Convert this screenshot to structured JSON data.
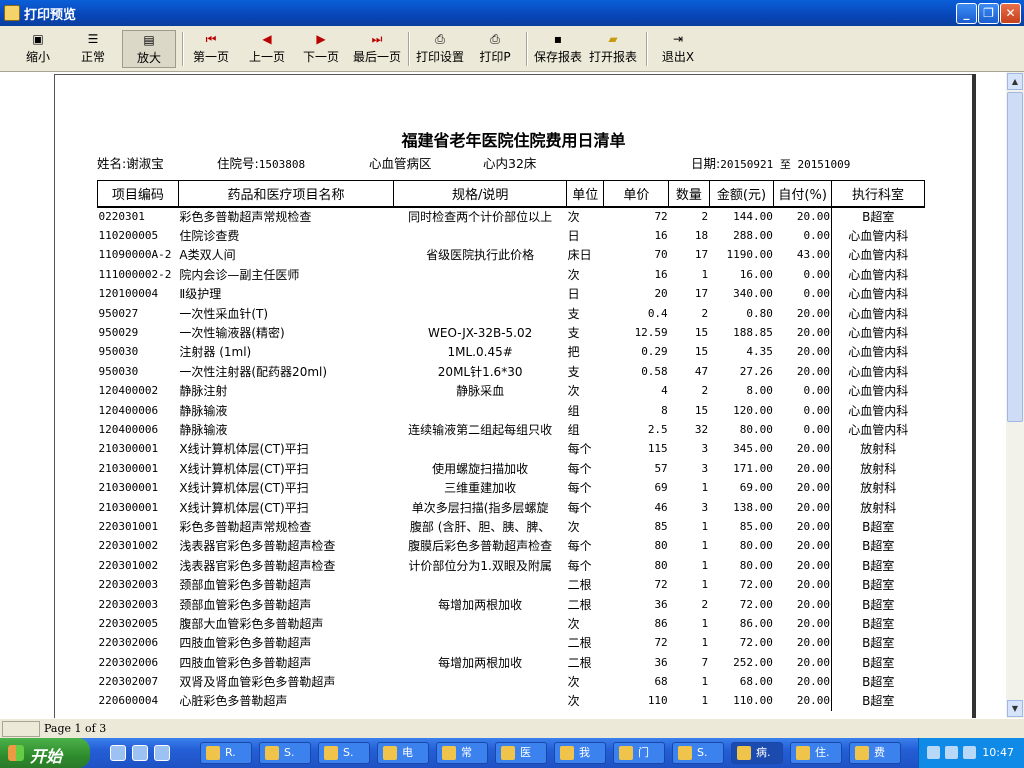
{
  "window": {
    "title": "打印预览"
  },
  "toolbar": {
    "shrink": "缩小",
    "normal": "正常",
    "zoom": "放大",
    "first": "第一页",
    "prev": "上一页",
    "next": "下一页",
    "last": "最后一页",
    "print_setup": "打印设置",
    "print": "打印P",
    "save_report": "保存报表",
    "open_report": "打开报表",
    "exit": "退出X"
  },
  "report": {
    "title": "福建省老年医院住院费用日清单",
    "name_label": "姓名:",
    "name": "谢淑宝",
    "admission_label": "住院号:",
    "admission_no": "1503808",
    "ward": "心血管病区",
    "bed": "心内32床",
    "date_label": "日期:",
    "date_range": "20150921 至 20151009",
    "columns": [
      "项目编码",
      "药品和医疗项目名称",
      "规格/说明",
      "单位",
      "单价",
      "数量",
      "金额(元)",
      "自付(%)",
      "执行科室"
    ],
    "rows": [
      [
        "0220301",
        "彩色多普勒超声常规检查",
        "同时检查两个计价部位以上",
        "次",
        "72",
        "2",
        "144.00",
        "20.00",
        "B超室"
      ],
      [
        "110200005",
        "住院诊查费",
        "",
        "日",
        "16",
        "18",
        "288.00",
        "0.00",
        "心血管内科"
      ],
      [
        "11090000A-2",
        "A类双人间",
        "省级医院执行此价格",
        "床日",
        "70",
        "17",
        "1190.00",
        "43.00",
        "心血管内科"
      ],
      [
        "111000002-2",
        "院内会诊—副主任医师",
        "",
        "次",
        "16",
        "1",
        "16.00",
        "0.00",
        "心血管内科"
      ],
      [
        "120100004",
        "Ⅱ级护理",
        "",
        "日",
        "20",
        "17",
        "340.00",
        "0.00",
        "心血管内科"
      ],
      [
        "950027",
        "一次性采血针(T)",
        "",
        "支",
        "0.4",
        "2",
        "0.80",
        "20.00",
        "心血管内科"
      ],
      [
        "950029",
        "一次性输液器(精密)",
        "WEO-JX-32B-5.02",
        "支",
        "12.59",
        "15",
        "188.85",
        "20.00",
        "心血管内科"
      ],
      [
        "950030",
        "注射器 (1ml)",
        "1ML.0.45#",
        "把",
        "0.29",
        "15",
        "4.35",
        "20.00",
        "心血管内科"
      ],
      [
        "950030",
        "一次性注射器(配药器20ml)",
        "20ML针1.6*30",
        "支",
        "0.58",
        "47",
        "27.26",
        "20.00",
        "心血管内科"
      ],
      [
        "120400002",
        "静脉注射",
        "静脉采血",
        "次",
        "4",
        "2",
        "8.00",
        "0.00",
        "心血管内科"
      ],
      [
        "120400006",
        "静脉输液",
        "",
        "组",
        "8",
        "15",
        "120.00",
        "0.00",
        "心血管内科"
      ],
      [
        "120400006",
        "静脉输液",
        "连续输液第二组起每组只收",
        "组",
        "2.5",
        "32",
        "80.00",
        "0.00",
        "心血管内科"
      ],
      [
        "210300001",
        "X线计算机体层(CT)平扫",
        "",
        "每个",
        "115",
        "3",
        "345.00",
        "20.00",
        "放射科"
      ],
      [
        "210300001",
        "X线计算机体层(CT)平扫",
        "使用螺旋扫描加收",
        "每个",
        "57",
        "3",
        "171.00",
        "20.00",
        "放射科"
      ],
      [
        "210300001",
        "X线计算机体层(CT)平扫",
        "三维重建加收",
        "每个",
        "69",
        "1",
        "69.00",
        "20.00",
        "放射科"
      ],
      [
        "210300001",
        "X线计算机体层(CT)平扫",
        "单次多层扫描(指多层螺旋",
        "每个",
        "46",
        "3",
        "138.00",
        "20.00",
        "放射科"
      ],
      [
        "220301001",
        "彩色多普勒超声常规检查",
        "腹部 (含肝、胆、胰、脾、",
        "次",
        "85",
        "1",
        "85.00",
        "20.00",
        "B超室"
      ],
      [
        "220301002",
        "浅表器官彩色多普勒超声检查",
        "腹膜后彩色多普勒超声检查",
        "每个",
        "80",
        "1",
        "80.00",
        "20.00",
        "B超室"
      ],
      [
        "220301002",
        "浅表器官彩色多普勒超声检查",
        "计价部位分为1.双眼及附属",
        "每个",
        "80",
        "1",
        "80.00",
        "20.00",
        "B超室"
      ],
      [
        "220302003",
        "颈部血管彩色多普勒超声",
        "",
        "二根",
        "72",
        "1",
        "72.00",
        "20.00",
        "B超室"
      ],
      [
        "220302003",
        "颈部血管彩色多普勒超声",
        "每增加两根加收",
        "二根",
        "36",
        "2",
        "72.00",
        "20.00",
        "B超室"
      ],
      [
        "220302005",
        "腹部大血管彩色多普勒超声",
        "",
        "次",
        "86",
        "1",
        "86.00",
        "20.00",
        "B超室"
      ],
      [
        "220302006",
        "四肢血管彩色多普勒超声",
        "",
        "二根",
        "72",
        "1",
        "72.00",
        "20.00",
        "B超室"
      ],
      [
        "220302006",
        "四肢血管彩色多普勒超声",
        "每增加两根加收",
        "二根",
        "36",
        "7",
        "252.00",
        "20.00",
        "B超室"
      ],
      [
        "220302007",
        "双肾及肾血管彩色多普勒超声",
        "",
        "次",
        "68",
        "1",
        "68.00",
        "20.00",
        "B超室"
      ],
      [
        "220600004",
        "心脏彩色多普勒超声",
        "",
        "次",
        "110",
        "1",
        "110.00",
        "20.00",
        "B超室"
      ]
    ]
  },
  "status": {
    "page": "Page 1 of 3"
  },
  "taskbar": {
    "start": "开始",
    "tasks": [
      "R.",
      "S.",
      "S.",
      "电",
      "常",
      "医",
      "我",
      "门",
      "S.",
      "病.",
      "住.",
      "费"
    ],
    "active_index": 9,
    "clock": "10:47"
  }
}
